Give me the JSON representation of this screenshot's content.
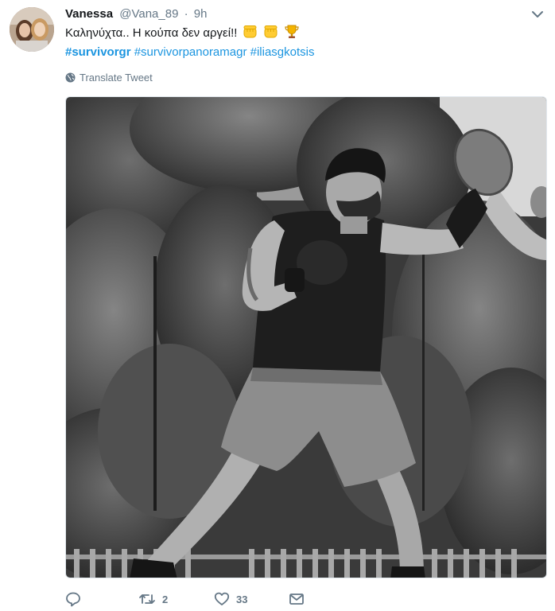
{
  "tweet": {
    "display_name": "Vanessa",
    "handle": "@Vana_89",
    "separator": "·",
    "timestamp": "9h",
    "text": "Καληνύχτα.. Η κούπα δεν αργεί!!",
    "emojis": [
      "raised-fist-icon",
      "raised-fist-icon",
      "trophy-icon"
    ],
    "hashtags": [
      {
        "text": "#survivorgr",
        "bold": true
      },
      {
        "text": "#survivorpanoramagr",
        "bold": false
      },
      {
        "text": "#iliasgkotsis",
        "bold": false
      }
    ],
    "translate_label": "Translate Tweet"
  },
  "actions": {
    "reply": {
      "icon": "reply-icon",
      "count": ""
    },
    "retweet": {
      "icon": "retweet-icon",
      "count": "2"
    },
    "like": {
      "icon": "heart-icon",
      "count": "33"
    },
    "message": {
      "icon": "envelope-icon",
      "count": ""
    }
  },
  "colors": {
    "link": "#1b95e0",
    "secondary_text": "#657786",
    "primary_text": "#14171a",
    "border": "#e1e8ed"
  }
}
